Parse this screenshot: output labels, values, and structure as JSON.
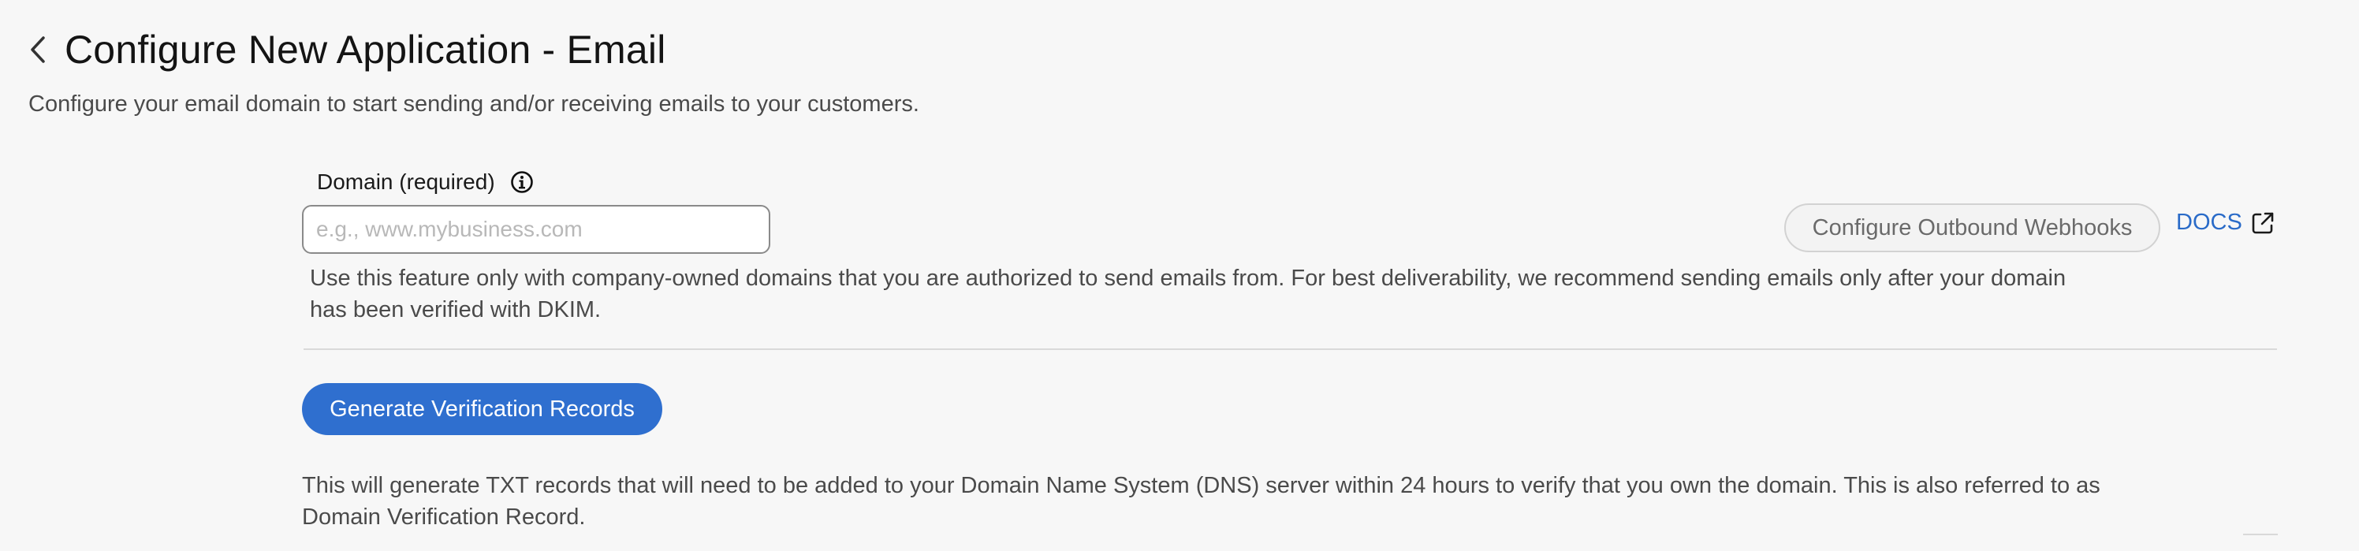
{
  "page": {
    "title": "Configure New Application - Email",
    "subtitle": "Configure your email domain to start sending and/or receiving emails to your customers."
  },
  "icons": {
    "back": "chevron-left-icon",
    "info": "info-circle-icon",
    "external_link": "external-link-icon"
  },
  "domain_field": {
    "label": "Domain (required)",
    "placeholder": "e.g., www.mybusiness.com",
    "value": "",
    "help_text": "Use this feature only with company-owned domains that you are authorized to send emails from. For best deliverability, we recommend sending emails only after your domain has been verified with DKIM."
  },
  "actions": {
    "webhooks_label": "Configure Outbound Webhooks",
    "docs_label": "DOCS",
    "generate_label": "Generate Verification Records"
  },
  "verification": {
    "description": "This will generate TXT records that will need to be added to your Domain Name System (DNS) server within 24 hours to verify that you own the domain. This is also referred to as Domain Verification Record."
  },
  "colors": {
    "background": "#f7f7f7",
    "primary": "#2f6fcf",
    "link": "#2a6bc8",
    "text_muted": "#4a4a4a"
  }
}
